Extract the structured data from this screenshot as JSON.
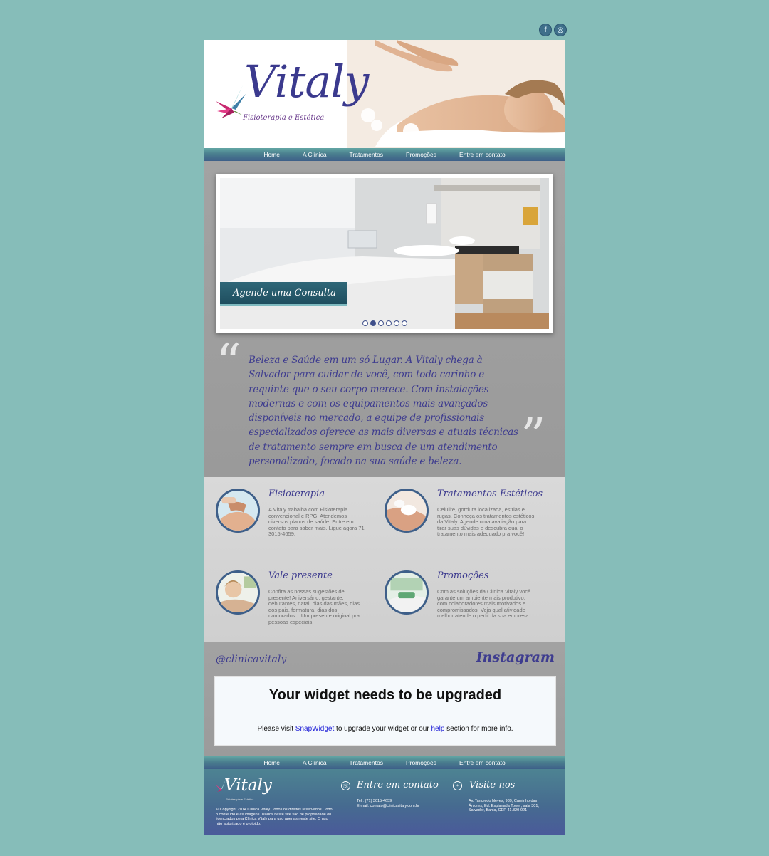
{
  "social": {
    "facebook_glyph": "f",
    "instagram_glyph": "◎"
  },
  "logo": {
    "word": "Vitaly",
    "subtitle": "Fisioterapia e Estética"
  },
  "nav": {
    "items": [
      "Home",
      "A Clínica",
      "Tratamentos",
      "Promoções",
      "Entre em contato"
    ]
  },
  "slider": {
    "cta": "Agende uma Consulta",
    "dot_count": 6,
    "active_dot": 1
  },
  "quote": {
    "text": "Beleza e Saúde em um só Lugar. A Vitaly chega à Salvador para cuidar de você, com todo carinho e requinte que o seu corpo merece. Com instalações modernas e com os equipamentos mais avançados disponíveis no mercado, a equipe de profissionais especializados oferece as mais diversas e atuais técnicas de tratamento sempre em busca de um atendimento personalizado, focado na sua saúde e beleza."
  },
  "features": [
    {
      "title": "Fisioterapia",
      "text": "A Vitaly trabalha com Fisioterapia convencional e RPG. Atendemos diversos planos de saúde. Entre em contato para saber mais. Ligue agora 71 3015-4659."
    },
    {
      "title": "Tratamentos Estéticos",
      "text": "Celulite, gordura localizada, estrias e rugas. Conheça os tratamentos estéticos da Vitaly. Agende uma avaliação para tirar suas dúvidas e descubra qual o tratamento mais adequado pra você!"
    },
    {
      "title": "Vale presente",
      "text": "Confira as nossas sugestões de presente! Aniversário, gestante, debutantes, natal, dias das mães, dias dos pais, formatura, dias dos namorados... Um presente original pra pessoas especiais."
    },
    {
      "title": "Promoções",
      "text": "Com as soluções da Clínica Vitaly você garante um ambiente mais produtivo, com colaboradores mais motivados e compromissados. Veja qual atividade melhor atende o perfil da sua empresa."
    }
  ],
  "instagram": {
    "handle": "@clinicavitaly",
    "logo_text": "Instagram",
    "widget_title": "Your widget needs to be upgraded",
    "widget_pre": "Please visit ",
    "widget_link1": "SnapWidget",
    "widget_mid": " to upgrade your widget or our ",
    "widget_link2": "help",
    "widget_post": " section for more info."
  },
  "footer": {
    "logo": "Vitaly",
    "logo_sub": "Fisioterapia e Estética",
    "copyright": "© Copyright 2014 Clínica Vitaly. Todos os direitos reservados. Todo o conteúdo e as imagens usados neste site são de propriedade ou licenciados pela Clínica Vitaly para uso apenas neste site. O uso não autorizado é proibido.",
    "contact_title": "Entre em contato",
    "contact_phone": "Tel.: (71) 3015-4659",
    "contact_email": "E-mail: contato@clinicavitaly.com.br",
    "visit_title": "Visite-nos",
    "address": "Av. Tancredo Neves, 939, Caminho das Árvores, Ed. Esplanada Tower, sala 301, Salvador, Bahia, CEP 41.820-021"
  },
  "colors": {
    "background": "#86bdb9",
    "brand_purple": "#3e3c8f",
    "nav_teal": "#4a7e8e"
  }
}
